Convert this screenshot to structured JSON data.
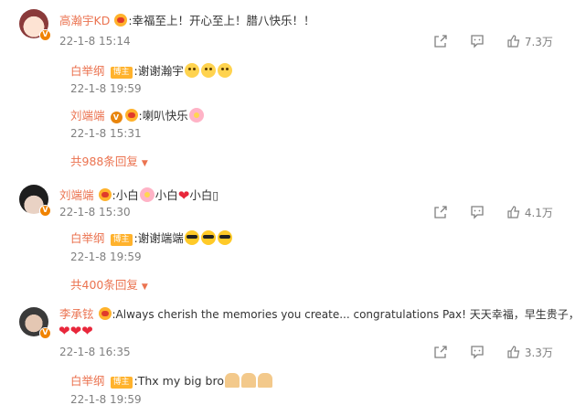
{
  "comments": [
    {
      "username": "高瀚宇KD",
      "text": ":幸福至上！开心至上！腊八快乐！！",
      "time": "22-1-8 15:14",
      "likes": "7.3万",
      "replies": [
        {
          "username": "白举纲",
          "badge": "博主",
          "text": ":谢谢瀚宇",
          "time": "22-1-8 19:59"
        },
        {
          "username": "刘端端",
          "text": ":喇叭快乐",
          "time": "22-1-8 15:31"
        }
      ],
      "more_replies": "共988条回复"
    },
    {
      "username": "刘端端",
      "text": [
        ":小白",
        "小白",
        "小白▯"
      ],
      "time": "22-1-8 15:30",
      "likes": "4.1万",
      "replies": [
        {
          "username": "白举纲",
          "badge": "博主",
          "text": ":谢谢端端",
          "time": "22-1-8 19:59"
        }
      ],
      "more_replies": "共400条回复"
    },
    {
      "username": "李承铉",
      "text": ":Always cherish the memories you create... congratulations Pax! 天天幸福，早生贵子，",
      "time": "22-1-8 16:35",
      "likes": "3.3万",
      "replies": [
        {
          "username": "白举纲",
          "badge": "博主",
          "text": ":Thx my big bro",
          "time": "22-1-8 19:59"
        }
      ]
    }
  ],
  "verified_badge": "V",
  "colors": {
    "username": "#eb7350",
    "time": "#808080",
    "bozhu": "#ffb22c",
    "heart": "#e8273b"
  },
  "icons": [
    "share-icon",
    "comment-icon",
    "like-icon",
    "verified-icon",
    "fan-badge-icon"
  ]
}
